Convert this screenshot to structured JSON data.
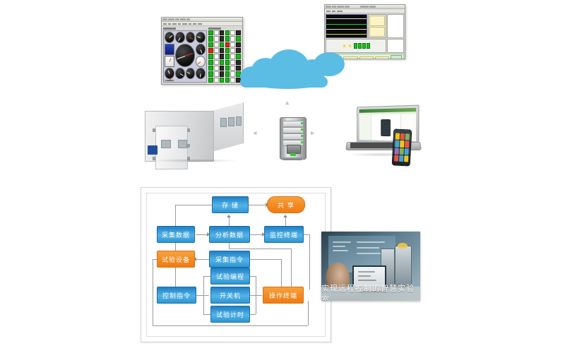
{
  "page": {
    "title": "实现远程控制的智慧实验室",
    "accent_blue": "#2f95d0",
    "accent_orange": "#f28a22",
    "cloud_color": "#5bbce4"
  },
  "cloud": {
    "label": "CLOUD",
    "icon": "cloud-icon"
  },
  "devices": {
    "gauge_window": {
      "name": "instrument-gauge-software-window"
    },
    "scada_window": {
      "name": "scada-monitoring-software-window"
    },
    "chamber": {
      "name": "walk-in-environmental-test-chamber"
    },
    "server": {
      "name": "data-server-tower"
    },
    "laptop": {
      "name": "laptop-dashboard"
    },
    "phone": {
      "name": "smartphone-app"
    },
    "arrows": {
      "up": "▲",
      "left": "◀",
      "right": "▶"
    }
  },
  "flow": {
    "nodes": [
      {
        "id": "store",
        "label": "存 储",
        "color": "blue",
        "shape": "rect"
      },
      {
        "id": "share",
        "label": "共 享",
        "color": "orange",
        "shape": "pill"
      },
      {
        "id": "collect",
        "label": "采集数据",
        "color": "blue",
        "shape": "rect"
      },
      {
        "id": "analyze",
        "label": "分析数据",
        "color": "blue",
        "shape": "rect"
      },
      {
        "id": "monitor",
        "label": "监控终端",
        "color": "blue",
        "shape": "rect"
      },
      {
        "id": "equipment",
        "label": "试验设备",
        "color": "orange",
        "shape": "rect"
      },
      {
        "id": "collect_cmd",
        "label": "采集指令",
        "color": "blue",
        "shape": "rect"
      },
      {
        "id": "program",
        "label": "试验编程",
        "color": "blue",
        "shape": "rect"
      },
      {
        "id": "control_cmd",
        "label": "控制指令",
        "color": "blue",
        "shape": "rect"
      },
      {
        "id": "power",
        "label": "开关机",
        "color": "blue",
        "shape": "rect"
      },
      {
        "id": "op_terminal",
        "label": "操作终端",
        "color": "orange",
        "shape": "rect"
      },
      {
        "id": "timing",
        "label": "试验计时",
        "color": "blue",
        "shape": "rect"
      }
    ]
  },
  "photo": {
    "caption": "实现远程控制的智慧实验室",
    "name": "smart-laboratory-photo"
  }
}
